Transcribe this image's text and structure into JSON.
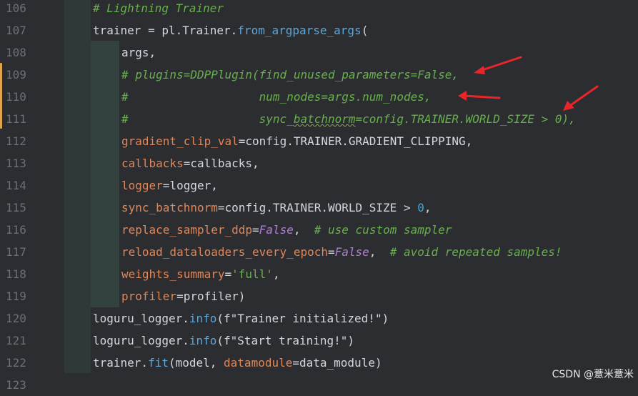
{
  "editor": {
    "lines": [
      {
        "num": "106",
        "indent": 1,
        "tokens": [
          {
            "cls": "t-comment",
            "text": "# Lightning Trainer"
          }
        ]
      },
      {
        "num": "107",
        "indent": 1,
        "tokens": [
          {
            "cls": "t-plain",
            "text": "trainer = pl.Trainer."
          },
          {
            "cls": "t-method",
            "text": "from_argparse_args"
          },
          {
            "cls": "t-plain",
            "text": "("
          }
        ]
      },
      {
        "num": "108",
        "indent": 2,
        "tokens": [
          {
            "cls": "t-plain",
            "text": "args,"
          }
        ]
      },
      {
        "num": "109",
        "indent": 2,
        "tokens": [
          {
            "cls": "t-comment",
            "text": "# plugins=DDPPlugin(find_unused_parameters=False,"
          }
        ]
      },
      {
        "num": "110",
        "indent": 2,
        "tokens": [
          {
            "cls": "t-comment",
            "text": "#                   num_nodes=args.num_nodes,"
          }
        ]
      },
      {
        "num": "111",
        "indent": 2,
        "tokens": [
          {
            "cls": "t-comment",
            "text": "#                   sync_"
          },
          {
            "cls": "t-comment underline",
            "text": "batchnorm"
          },
          {
            "cls": "t-comment",
            "text": "=config.TRAINER.WORLD_SIZE > 0),"
          }
        ]
      },
      {
        "num": "112",
        "indent": 2,
        "tokens": [
          {
            "cls": "t-param",
            "text": "gradient_clip_val"
          },
          {
            "cls": "t-plain",
            "text": "=config.TRAINER.GRADIENT_CLIPPING,"
          }
        ]
      },
      {
        "num": "113",
        "indent": 2,
        "tokens": [
          {
            "cls": "t-param",
            "text": "callbacks"
          },
          {
            "cls": "t-plain",
            "text": "=callbacks,"
          }
        ]
      },
      {
        "num": "114",
        "indent": 2,
        "tokens": [
          {
            "cls": "t-param",
            "text": "logger"
          },
          {
            "cls": "t-plain",
            "text": "=logger,"
          }
        ]
      },
      {
        "num": "115",
        "indent": 2,
        "tokens": [
          {
            "cls": "t-param",
            "text": "sync_batchnorm"
          },
          {
            "cls": "t-plain",
            "text": "=config.TRAINER.WORLD_SIZE > "
          },
          {
            "cls": "t-num",
            "text": "0"
          },
          {
            "cls": "t-plain",
            "text": ","
          }
        ]
      },
      {
        "num": "116",
        "indent": 2,
        "tokens": [
          {
            "cls": "t-param",
            "text": "replace_sampler_ddp"
          },
          {
            "cls": "t-plain",
            "text": "="
          },
          {
            "cls": "t-kw",
            "text": "False"
          },
          {
            "cls": "t-plain",
            "text": ",  "
          },
          {
            "cls": "t-comment",
            "text": "# use custom sampler"
          }
        ]
      },
      {
        "num": "117",
        "indent": 2,
        "tokens": [
          {
            "cls": "t-param",
            "text": "reload_dataloaders_every_epoch"
          },
          {
            "cls": "t-plain",
            "text": "="
          },
          {
            "cls": "t-kw",
            "text": "False"
          },
          {
            "cls": "t-plain",
            "text": ",  "
          },
          {
            "cls": "t-comment",
            "text": "# avoid repeated samples!"
          }
        ]
      },
      {
        "num": "118",
        "indent": 2,
        "tokens": [
          {
            "cls": "t-param",
            "text": "weights_summary"
          },
          {
            "cls": "t-plain",
            "text": "="
          },
          {
            "cls": "t-str",
            "text": "'full'"
          },
          {
            "cls": "t-plain",
            "text": ","
          }
        ]
      },
      {
        "num": "119",
        "indent": 2,
        "tokens": [
          {
            "cls": "t-param",
            "text": "profiler"
          },
          {
            "cls": "t-plain",
            "text": "=profiler)"
          }
        ]
      },
      {
        "num": "120",
        "indent": 1,
        "tokens": [
          {
            "cls": "t-plain",
            "text": "loguru_logger."
          },
          {
            "cls": "t-method",
            "text": "info"
          },
          {
            "cls": "t-plain",
            "text": "(f\"Trainer initialized!\")"
          }
        ]
      },
      {
        "num": "121",
        "indent": 1,
        "tokens": [
          {
            "cls": "t-plain",
            "text": "loguru_logger."
          },
          {
            "cls": "t-method",
            "text": "info"
          },
          {
            "cls": "t-plain",
            "text": "(f\"Start training!\")"
          }
        ]
      },
      {
        "num": "122",
        "indent": 1,
        "tokens": [
          {
            "cls": "t-plain",
            "text": "trainer."
          },
          {
            "cls": "t-method",
            "text": "fit"
          },
          {
            "cls": "t-plain",
            "text": "(model, "
          },
          {
            "cls": "t-param",
            "text": "datamodule"
          },
          {
            "cls": "t-plain",
            "text": "=data_module)"
          }
        ]
      },
      {
        "num": "123",
        "indent": 1,
        "tokens": []
      }
    ]
  },
  "annotations": {
    "arrow_color": "#e8262a",
    "arrow_count": 3
  },
  "watermark": {
    "text": "CSDN @薏米薏米"
  },
  "colors": {
    "background": "#2b2d30",
    "comment": "#68b04c",
    "param": "#e0875a",
    "method": "#5da6d8",
    "keyword": "#b07fd6",
    "line_number": "#6b6f76"
  }
}
